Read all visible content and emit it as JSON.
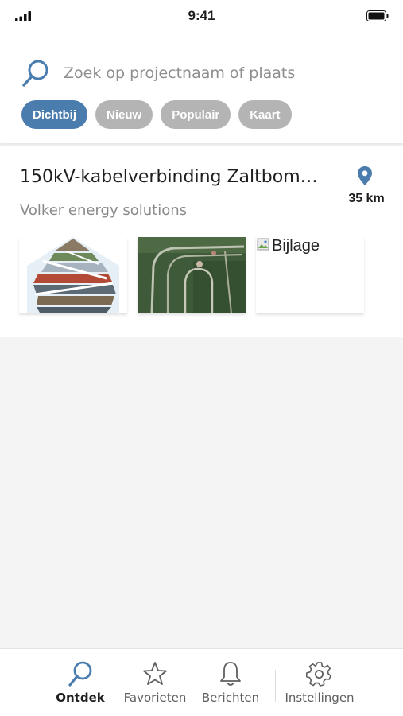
{
  "status_bar": {
    "time": "9:41",
    "signal_icon": "cellular-signal-icon",
    "battery_icon": "battery-icon"
  },
  "search": {
    "placeholder": "Zoek op projectnaam of plaats",
    "value": "",
    "icon": "search-icon"
  },
  "filters": [
    {
      "label": "Dichtbij",
      "active": true
    },
    {
      "label": "Nieuw",
      "active": false
    },
    {
      "label": "Populair",
      "active": false
    },
    {
      "label": "Kaart",
      "active": false
    }
  ],
  "results": [
    {
      "title": "150kV-kabelverbinding Zaltbom…",
      "company": "Volker energy solutions",
      "distance": "35 km",
      "attachments": [
        {
          "kind": "image",
          "icon": "collage-image"
        },
        {
          "kind": "image",
          "icon": "aerial-map-image"
        },
        {
          "kind": "broken-image",
          "alt": "Bijlage"
        }
      ]
    }
  ],
  "tabs": [
    {
      "label": "Ontdek",
      "icon": "search-icon",
      "active": true
    },
    {
      "label": "Favorieten",
      "icon": "star-icon",
      "active": false
    },
    {
      "label": "Berichten",
      "icon": "bell-icon",
      "active": false
    },
    {
      "label": "Instellingen",
      "icon": "gear-icon",
      "active": false
    }
  ],
  "colors": {
    "accent": "#4a7cae",
    "chip_inactive": "#b4b4b4",
    "background": "#f4f4f4",
    "subtitle": "#8a8a8a"
  }
}
